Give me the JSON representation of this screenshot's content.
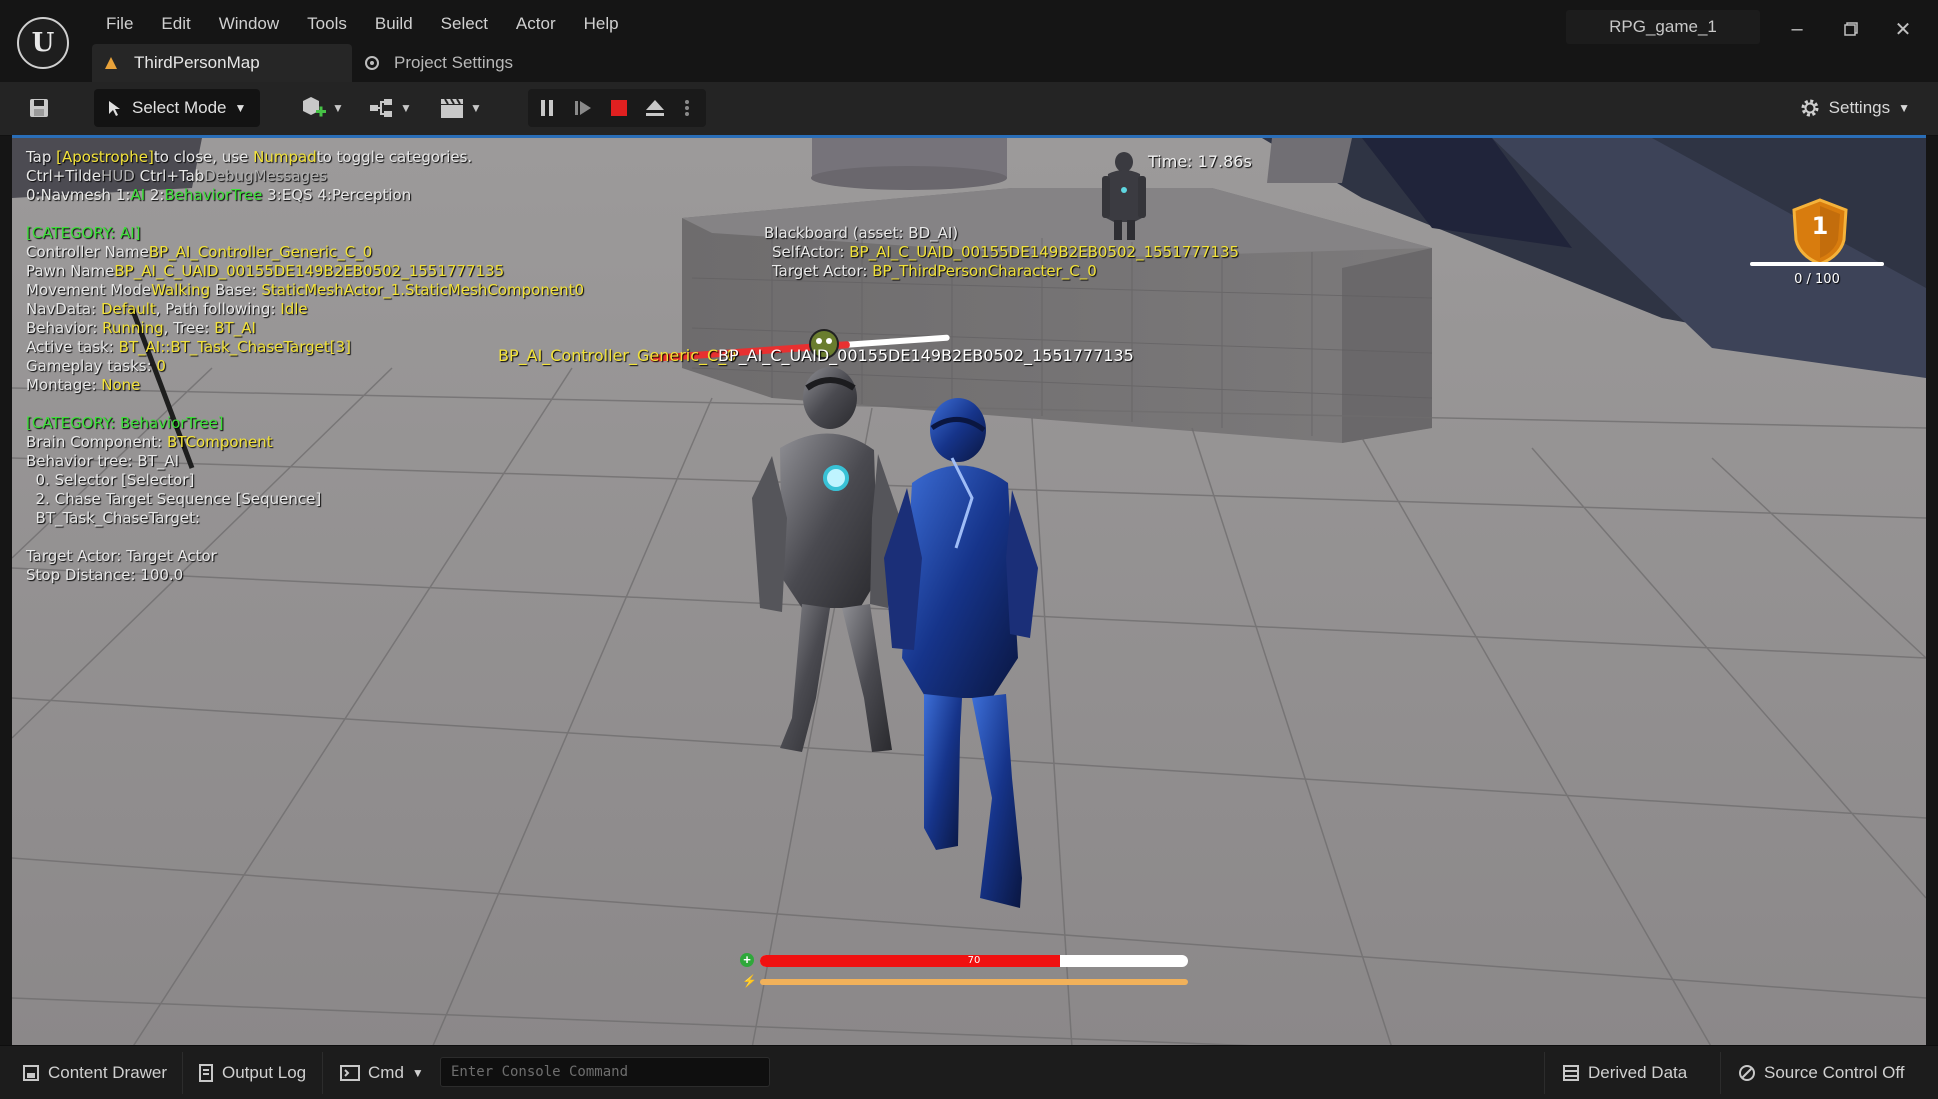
{
  "titlebar": {
    "menu": [
      "File",
      "Edit",
      "Window",
      "Tools",
      "Build",
      "Select",
      "Actor",
      "Help"
    ],
    "tab_active": "ThirdPersonMap",
    "tab_second": "Project Settings",
    "project_name": "RPG_game_1"
  },
  "toolbar": {
    "select_mode": "Select Mode",
    "settings": "Settings"
  },
  "debug": {
    "line1": {
      "a": "Tap ",
      "b": "[Apostrophe]",
      "c": "to close, use ",
      "d": "Numpad",
      "e": "to toggle categories."
    },
    "line2": {
      "a": "Ctrl+Tilde",
      "b": "HUD",
      "c": "  Ctrl+Tab",
      "d": "DebugMessages"
    },
    "line3": {
      "a": "0:",
      "b": "Navmesh",
      "c": "  1:",
      "d": "AI",
      "e": "  2:",
      "f": "BehaviorTree",
      "g": "  3:",
      "h": "EQS",
      "i": "  4:",
      "j": "Perception"
    },
    "category_ai": "[CATEGORY: AI]",
    "controller_label": "Controller Name",
    "controller_value": "BP_AI_Controller_Generic_C_0",
    "pawn_label": "Pawn Name",
    "pawn_value": "BP_AI_C_UAID_00155DE149B2EB0502_1551777135",
    "movement_label": "Movement Mode",
    "movement_value": "Walking",
    "base_label": "  Base: ",
    "base_value": "StaticMeshActor_1.StaticMeshComponent0",
    "navdata_label": "NavData: ",
    "navdata_value": "Default",
    "path_label": ", Path following: ",
    "path_value": "Idle",
    "behavior_label": "Behavior: ",
    "behavior_value": "Running",
    "tree_label": ", Tree: ",
    "tree_value": "BT_AI",
    "active_task_label": "Active task: ",
    "active_task_value": "BT_AI::BT_Task_ChaseTarget[3]",
    "gameplay_label": "Gameplay tasks: ",
    "gameplay_value": "0",
    "montage_label": "Montage: ",
    "montage_value": "None",
    "category_bt": "[CATEGORY: BehaviorTree]",
    "brain_label": "Brain Component: ",
    "brain_value": "BTComponent",
    "bt_line": "Behavior tree: BT_AI",
    "bt_0": "  0. Selector [Selector]",
    "bt_2": "  2. Chase Target Sequence [Sequence]",
    "bt_task": "  BT_Task_ChaseTarget:",
    "target_actor": "Target Actor: Target Actor",
    "stop_distance": "Stop Distance: 100.0"
  },
  "blackboard": {
    "title": "Blackboard (asset: BD_AI)",
    "self_label": "SelfActor: ",
    "self_value": "BP_AI_C_UAID_00155DE149B2EB0502_1551777135",
    "target_label": "Target Actor: ",
    "target_value": "BP_ThirdPersonCharacter_C_0"
  },
  "overhead": {
    "controller": "BP_AI_Controller_Generic_C_0",
    "pawn": "BP_AI_C_UAID_00155DE149B2EB0502_1551777135"
  },
  "hud": {
    "time": "Time: 17.86s",
    "level": "1",
    "xp_text": "0 / 100",
    "xp_fraction": 0.0,
    "hp_value": "70",
    "hp_fraction": 0.7,
    "stamina_fraction": 1.0
  },
  "statusbar": {
    "content_drawer": "Content Drawer",
    "output_log": "Output Log",
    "cmd": "Cmd",
    "console_placeholder": "Enter Console Command",
    "derived_data": "Derived Data",
    "source_control": "Source Control Off"
  },
  "colors": {
    "accent_blue": "#2a6eb8",
    "debug_yellow": "#f2e23a",
    "debug_green": "#3ee03a",
    "hp_red": "#f01010",
    "stamina_orange": "#f1b15a",
    "stop_red": "#e02020"
  },
  "icons": {
    "logo": "unreal-logo-icon",
    "save": "save-icon",
    "settings": "gear-icon"
  }
}
